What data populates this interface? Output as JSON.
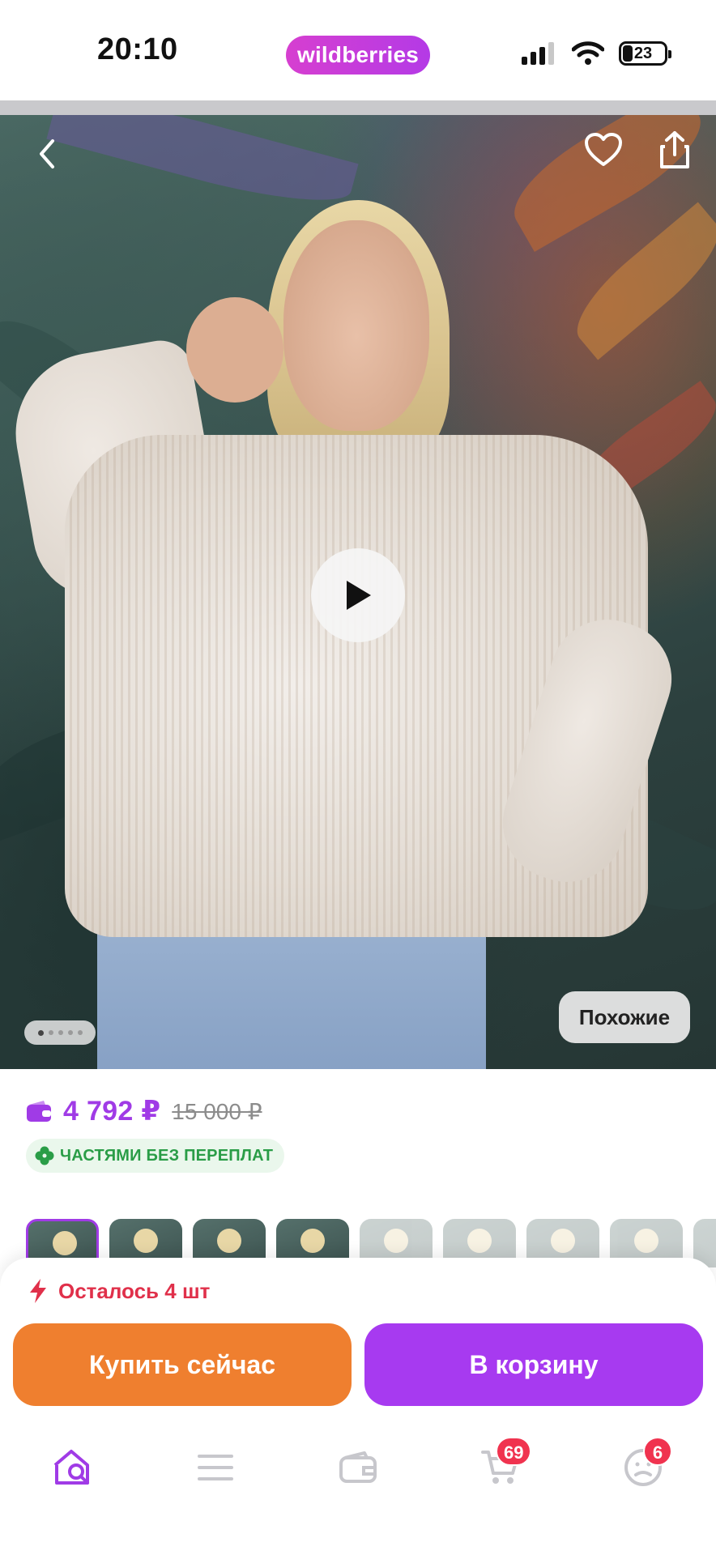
{
  "status_bar": {
    "time": "20:10",
    "brand": "wildberries",
    "battery_level": "23"
  },
  "product": {
    "price_current": "4 792 ₽",
    "price_old": "15 000 ₽",
    "installment_label": "ЧАСТЯМИ БЕЗ ПЕРЕПЛАТ",
    "similar_label": "Похожие",
    "gallery": {
      "image_count": 5,
      "active_index": 1
    },
    "thumbnails": {
      "count": 9,
      "active_index": 0
    }
  },
  "stock": {
    "label": "Осталось 4 шт"
  },
  "actions": {
    "buy_now": "Купить сейчас",
    "add_to_cart": "В корзину"
  },
  "nav": {
    "items": [
      {
        "name": "home-search",
        "active": true
      },
      {
        "name": "catalog"
      },
      {
        "name": "wallet"
      },
      {
        "name": "cart",
        "badge": "69"
      },
      {
        "name": "profile",
        "badge": "6"
      }
    ]
  },
  "colors": {
    "accent": "#a03be6",
    "buy_now": "#ef7f2f",
    "cart": "#a73af0",
    "stock_alert": "#e0304a",
    "installment": "#2a9d47",
    "badge": "#f0334f"
  }
}
